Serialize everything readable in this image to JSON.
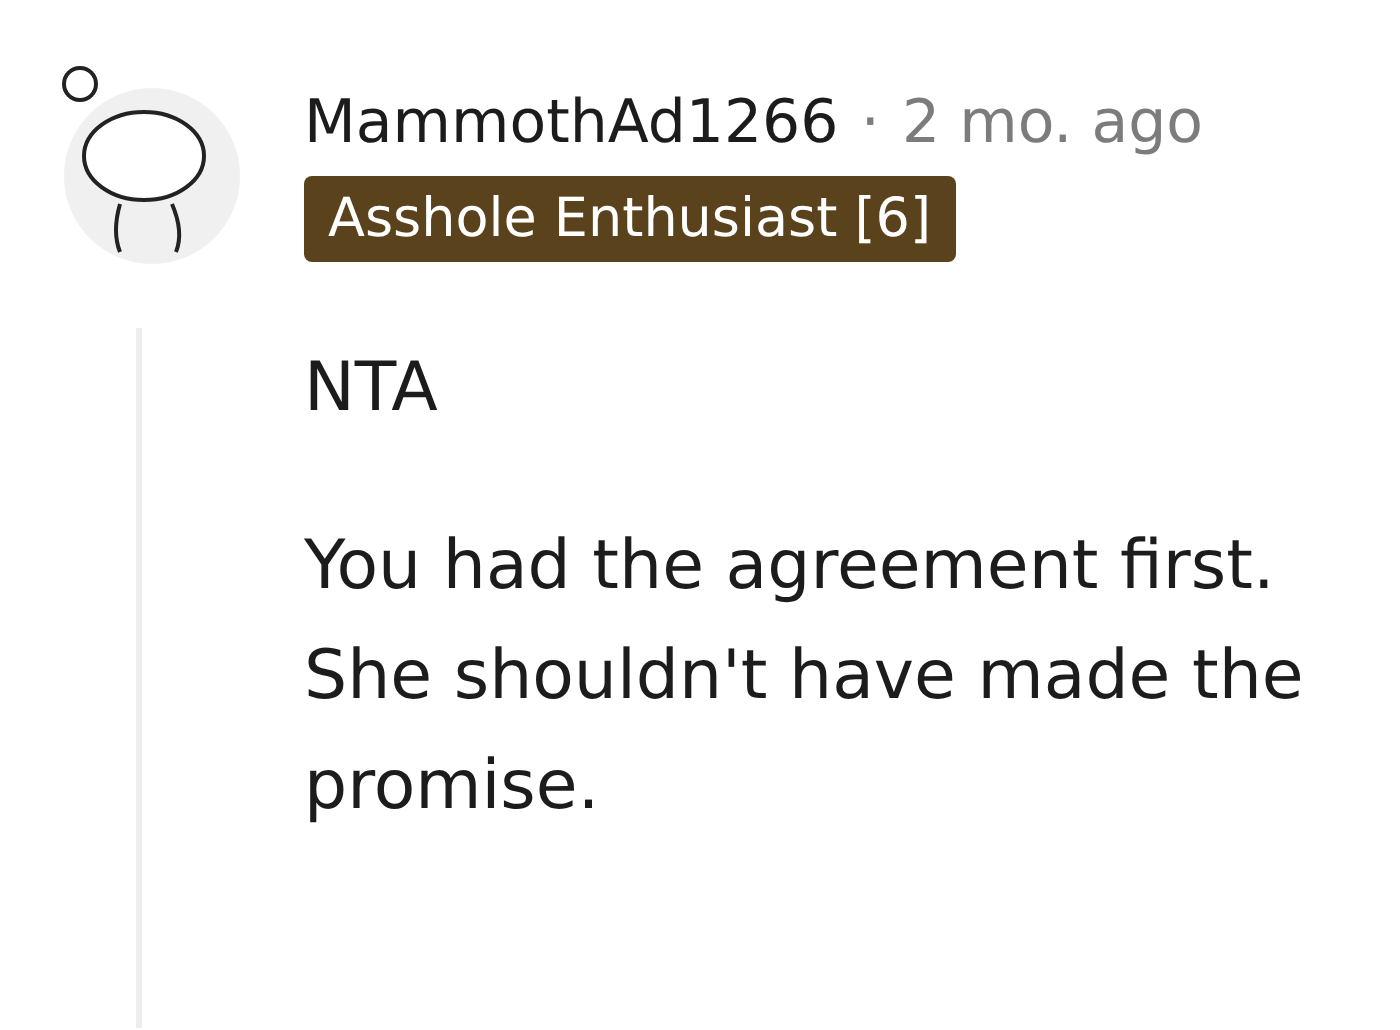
{
  "comment": {
    "author": "MammothAd1266",
    "separator": "·",
    "time": "2 mo. ago",
    "flair": "Asshole Enthusiast [6]",
    "paragraphs": [
      "NTA",
      "You had the agreement first. She shouldn't have made the promise."
    ]
  }
}
